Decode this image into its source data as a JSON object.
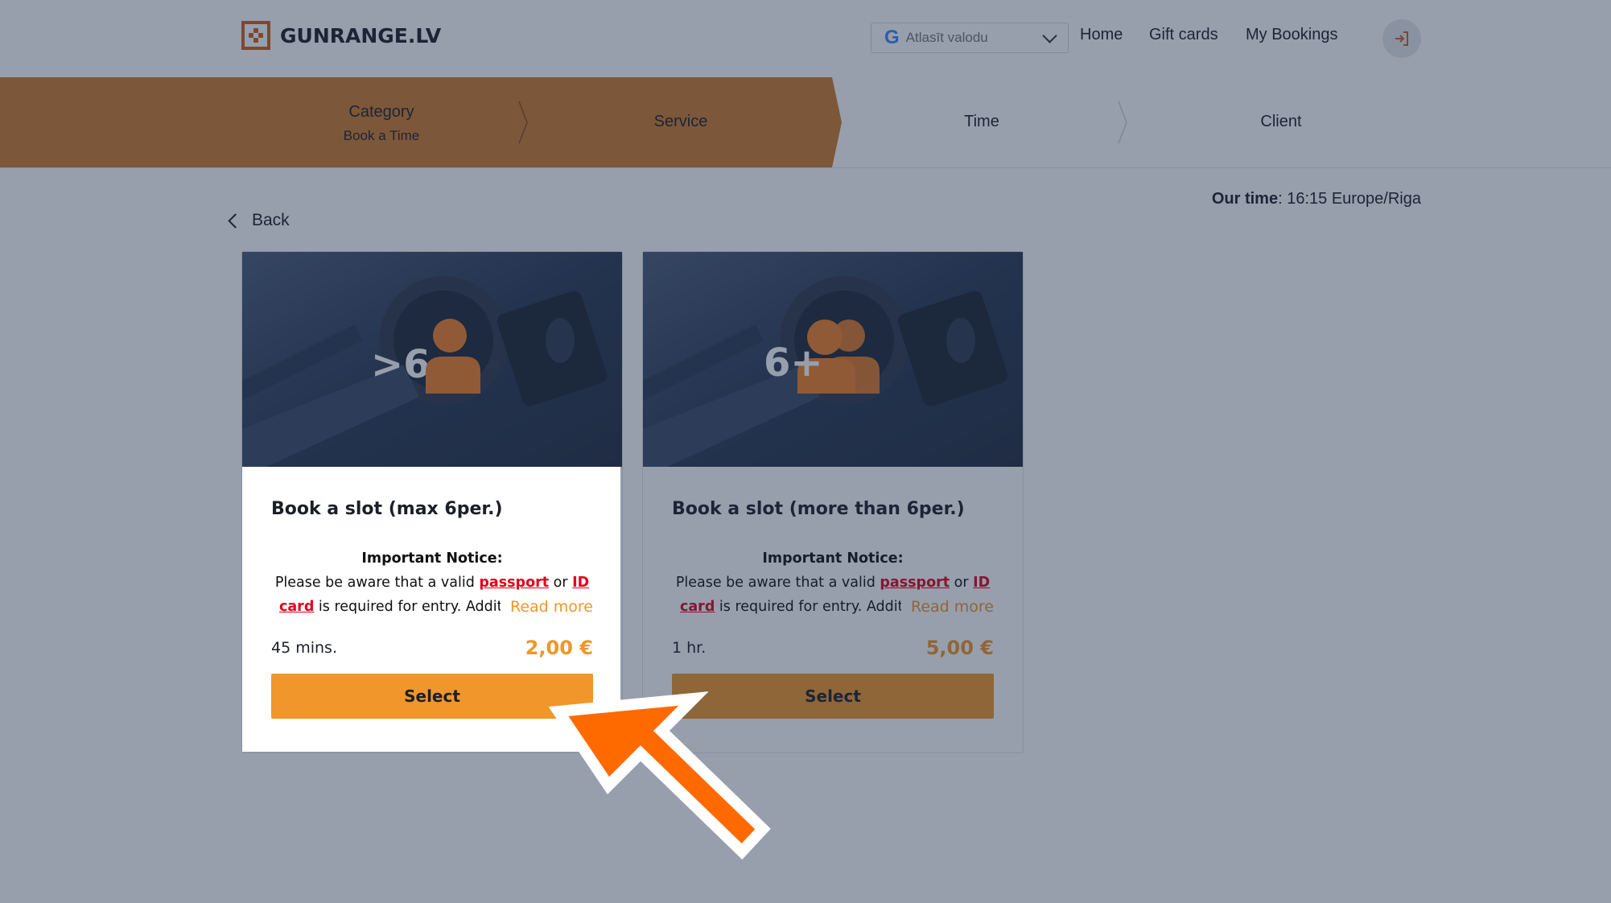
{
  "header": {
    "logo_text": "GUNRANGE.LV",
    "language_select": {
      "icon": "G",
      "value": "Atlasīt valodu"
    },
    "nav": [
      "Home",
      "Gift cards",
      "My Bookings"
    ],
    "login_icon": "login-icon"
  },
  "stepper": {
    "steps": [
      {
        "title": "Category",
        "subtitle": "Book a Time",
        "state": "done"
      },
      {
        "title": "Service",
        "subtitle": "",
        "state": "active"
      },
      {
        "title": "Time",
        "subtitle": "",
        "state": "pending"
      },
      {
        "title": "Client",
        "subtitle": "",
        "state": "pending"
      }
    ],
    "active_color": "#cf7a2e"
  },
  "main": {
    "our_time_label": "Our time",
    "our_time_value": ": 16:15 Europe/Riga",
    "back_label": "Back"
  },
  "cards": [
    {
      "badge": ">6",
      "title": "Book a slot (max 6per.)",
      "notice_heading": "Important Notice:",
      "notice_pre": "Please be aware that a valid ",
      "link1": "passport",
      "notice_mid": " or ",
      "link2a": "ID",
      "link2b": "card",
      "notice_post": " is required for entry. Additi",
      "read_more": "Read more",
      "duration": "45 mins.",
      "price": "2,00 €",
      "button": "Select"
    },
    {
      "badge": "6+",
      "title": "Book a slot (more than 6per.)",
      "notice_heading": "Important Notice:",
      "notice_pre": "Please be aware that a valid ",
      "link1": "passport",
      "notice_mid": " or ",
      "link2a": "ID",
      "link2b": "card",
      "notice_post": " is required for entry. Additi",
      "read_more": "Read more",
      "duration": "1 hr.",
      "price": "5,00 €",
      "button": "Select"
    }
  ],
  "colors": {
    "accent": "#f0962a",
    "brand": "#cf5f1d",
    "arrow": "#ff6a00",
    "link": "#e2001a"
  }
}
